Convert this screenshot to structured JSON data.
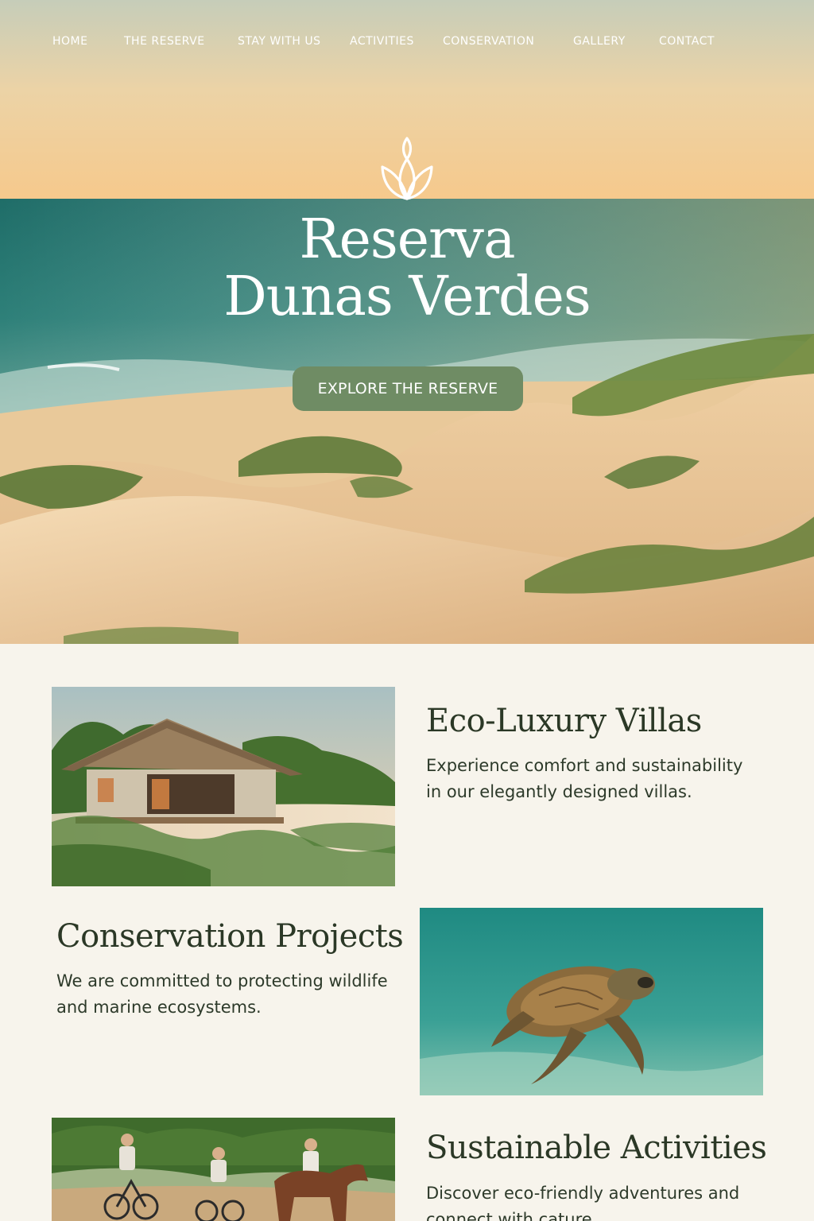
{
  "nav": {
    "items": [
      "HOME",
      "THE RESERVE",
      "STAY WITH US",
      "ACTIVITIES",
      "CONSERVATION",
      "GALLERY",
      "CONTACT"
    ]
  },
  "hero": {
    "title_line1": "Reserva",
    "title_line2": "Dunas Verdes",
    "cta_label": "EXPLORE THE RESERVE",
    "logo_icon": "leaf-icon"
  },
  "features": [
    {
      "title": "Eco-Luxury Villas",
      "text": "Experience comfort and sustainability in our elegantly designed villas.",
      "image": "thatched-villa-on-dunes"
    },
    {
      "title": "Conservation Projects",
      "text": "We are committed to protecting wildlife and marine ecosystems.",
      "image": "sea-turtle-underwater"
    },
    {
      "title": "Sustainable Activities",
      "text": "Discover eco-friendly adventures and connect with cature",
      "image": "cyclists-and-horse-rider-on-trail"
    }
  ],
  "colors": {
    "accent": "#6f8c64",
    "background": "#f7f4ec",
    "heading": "#2b3826"
  }
}
